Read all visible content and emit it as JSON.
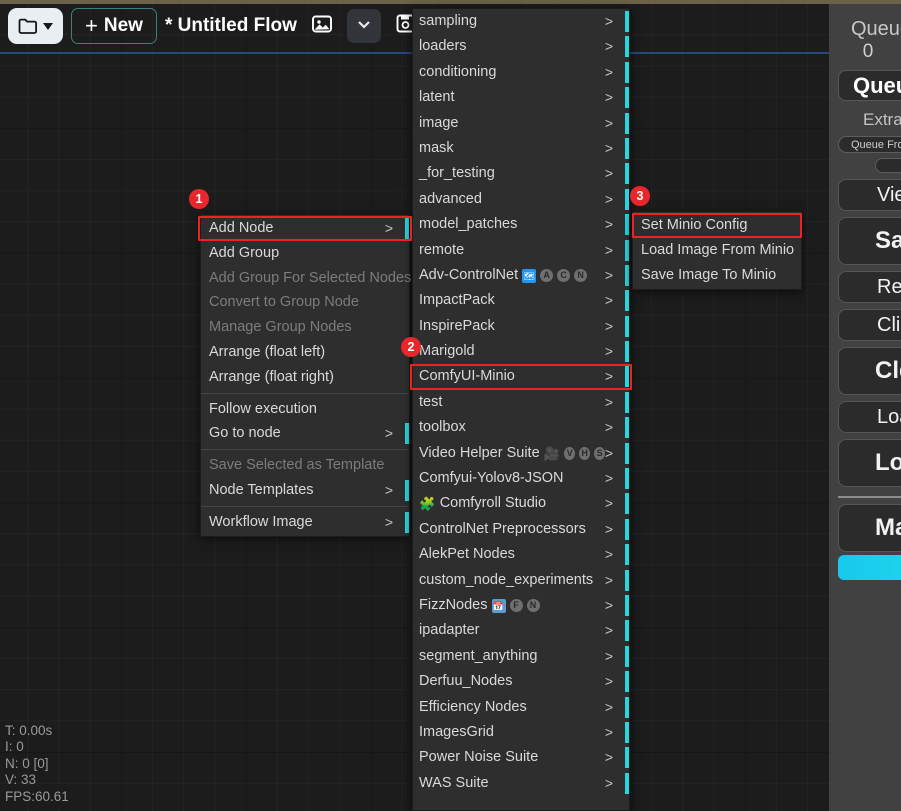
{
  "toolbar": {
    "folder_icon": "folder-icon",
    "folder_caret": "chevron-down-icon",
    "new_plus": "+",
    "new_label": "New",
    "workflow_title": "* Untitled Flow",
    "image_icon": "image-icon",
    "dropdown_icon": "chevron-down-icon",
    "save_icon": "save-icon"
  },
  "context_menu": {
    "items": [
      {
        "label": "Add Node",
        "submenu": true,
        "disabled": false,
        "highlighted": true
      },
      {
        "label": "Add Group",
        "submenu": false,
        "disabled": false
      },
      {
        "label": "Add Group For Selected Nodes",
        "submenu": false,
        "disabled": true
      },
      {
        "label": "Convert to Group Node",
        "submenu": false,
        "disabled": true
      },
      {
        "label": "Manage Group Nodes",
        "submenu": false,
        "disabled": true
      },
      {
        "label": "Arrange (float left)",
        "submenu": false,
        "disabled": false
      },
      {
        "label": "Arrange (float right)",
        "submenu": false,
        "disabled": false
      },
      {
        "separator": true
      },
      {
        "label": "Follow execution",
        "submenu": false,
        "disabled": false
      },
      {
        "label": "Go to node",
        "submenu": true,
        "disabled": false
      },
      {
        "separator": true
      },
      {
        "label": "Save Selected as Template",
        "submenu": false,
        "disabled": true
      },
      {
        "label": "Node Templates",
        "submenu": true,
        "disabled": false
      },
      {
        "separator": true
      },
      {
        "label": "Workflow Image",
        "submenu": true,
        "disabled": false
      }
    ]
  },
  "node_categories": {
    "items": [
      {
        "label": "sampling",
        "submenu": true
      },
      {
        "label": "loaders",
        "submenu": true
      },
      {
        "label": "conditioning",
        "submenu": true
      },
      {
        "label": "latent",
        "submenu": true
      },
      {
        "label": "image",
        "submenu": true
      },
      {
        "label": "mask",
        "submenu": true
      },
      {
        "label": "_for_testing",
        "submenu": true
      },
      {
        "label": "advanced",
        "submenu": true
      },
      {
        "label": "model_patches",
        "submenu": true
      },
      {
        "label": "remote",
        "submenu": true
      },
      {
        "label": "Adv-ControlNet",
        "submenu": true,
        "icons": [
          "blue-square-icon",
          "circle-a-icon",
          "circle-c-icon",
          "circle-n-icon"
        ]
      },
      {
        "label": "ImpactPack",
        "submenu": true
      },
      {
        "label": "InspirePack",
        "submenu": true
      },
      {
        "label": "Marigold",
        "submenu": true
      },
      {
        "label": "ComfyUI-Minio",
        "submenu": true,
        "highlighted": true
      },
      {
        "label": "test",
        "submenu": true
      },
      {
        "label": "toolbox",
        "submenu": true
      },
      {
        "label": "Video Helper Suite",
        "submenu": true,
        "icons": [
          "camera-icon",
          "circle-v-icon",
          "circle-h-icon",
          "circle-s-icon"
        ]
      },
      {
        "label": "Comfyui-Yolov8-JSON",
        "submenu": true
      },
      {
        "label": "Comfyroll Studio",
        "submenu": true,
        "prefix_icon": "puzzle-icon"
      },
      {
        "label": "ControlNet Preprocessors",
        "submenu": true
      },
      {
        "label": "AlekPet Nodes",
        "submenu": true
      },
      {
        "label": "custom_node_experiments",
        "submenu": true
      },
      {
        "label": "FizzNodes",
        "submenu": true,
        "icons": [
          "calendar-icon",
          "circle-f-icon",
          "circle-n-icon"
        ]
      },
      {
        "label": "ipadapter",
        "submenu": true
      },
      {
        "label": "segment_anything",
        "submenu": true
      },
      {
        "label": "Derfuu_Nodes",
        "submenu": true
      },
      {
        "label": "Efficiency Nodes",
        "submenu": true
      },
      {
        "label": "ImagesGrid",
        "submenu": true
      },
      {
        "label": "Power Noise Suite",
        "submenu": true
      },
      {
        "label": "WAS Suite",
        "submenu": true
      }
    ]
  },
  "minio_submenu": {
    "items": [
      {
        "label": "Set Minio Config",
        "highlighted": true
      },
      {
        "label": "Load Image From Minio",
        "highlighted": false
      },
      {
        "label": "Save Image To Minio",
        "highlighted": false
      }
    ]
  },
  "annotations": {
    "badges": [
      {
        "number": "1"
      },
      {
        "number": "2"
      },
      {
        "number": "3"
      }
    ]
  },
  "sidebar": {
    "queue_title": "Queue size:",
    "queue_count": "0",
    "queue_button": "Queue Prompt",
    "extra_options": "Extra options",
    "queue_front_pill": "Queue Front",
    "view_queue": "View Queue",
    "save_button": "Save",
    "load_button": "Load",
    "refresh_button": "Refresh",
    "clipspace_button": "Clipspace",
    "clear_button": "Clear",
    "load_default_button": "Load Default",
    "manager_button": "Manager",
    "accent_color": "#1cd0ec"
  },
  "stats": {
    "time": "T: 0.00s",
    "iterations": "I: 0",
    "nodes": "N: 0 [0]",
    "version": "V: 33",
    "fps": "FPS:60.61"
  },
  "colors": {
    "canvas_bg": "#1c1c1c",
    "menu_bg": "#2e2e2e",
    "highlight_red": "#ee2222",
    "badge_red": "#e8272c",
    "cyan_edge": "#29d6e0",
    "link_blue": "#274a7d",
    "sidebar_bg": "#414141"
  }
}
